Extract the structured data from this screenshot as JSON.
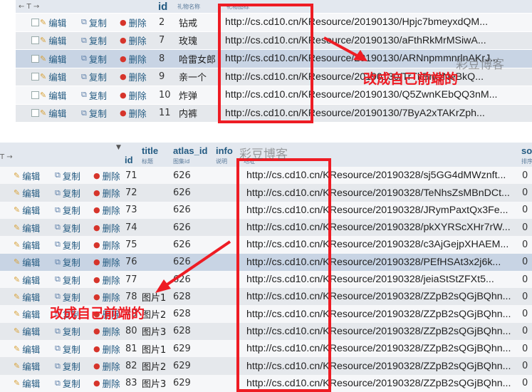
{
  "actions": {
    "edit": "编辑",
    "copy": "复制",
    "delete": "删除"
  },
  "table1": {
    "headers": {
      "sort": "← T →",
      "id": "id",
      "name": "礼物名称",
      "url": "礼物图标"
    },
    "rows": [
      {
        "id": "2",
        "name": "钻戒",
        "url": "http://cs.cd10.cn/KResource/20190130/Hpjc7bmeyxdQM..."
      },
      {
        "id": "7",
        "name": "玫瑰",
        "url": "http://cs.cd10.cn/KResource/20190130/aFthRkMrMSiwA..."
      },
      {
        "id": "8",
        "name": "哈雷女郎",
        "url": "http://cs.cd10.cn/KResource/20190130/ARNnpmmnrlnAKrJ..."
      },
      {
        "id": "9",
        "name": "亲一个",
        "url": "http://cs.cd10.cn/KResource/20190130/TrTkBnQNeBkQ..."
      },
      {
        "id": "10",
        "name": "炸弹",
        "url": "http://cs.cd10.cn/KResource/20190130/Q5ZwnKEbQQ3nM..."
      },
      {
        "id": "11",
        "name": "内裤",
        "url": "http://cs.cd10.cn/KResource/20190130/7ByA2xTAKrZph..."
      }
    ]
  },
  "table2": {
    "headers": {
      "sort": "T →",
      "id": "id",
      "title": "title",
      "title_sub": "标题",
      "atlas": "atlas_id",
      "atlas_sub": "图集id",
      "info": "info",
      "info_sub": "说明",
      "url_sub": "地址",
      "sort_col": "so",
      "sort_sub": "排序"
    },
    "rows": [
      {
        "id": "71",
        "title": "",
        "atlas": "626",
        "url": "http://cs.cd10.cn/KResource/20190328/sj5GG4dMWznft...",
        "so": "0"
      },
      {
        "id": "72",
        "title": "",
        "atlas": "626",
        "url": "http://cs.cd10.cn/KResource/20190328/TeNhsZsMBnDCt...",
        "so": "0"
      },
      {
        "id": "73",
        "title": "",
        "atlas": "626",
        "url": "http://cs.cd10.cn/KResource/20190328/JRymPaxtQx3Fe...",
        "so": "0"
      },
      {
        "id": "74",
        "title": "",
        "atlas": "626",
        "url": "http://cs.cd10.cn/KResource/20190328/pkXYRScXHr7rW...",
        "so": "0"
      },
      {
        "id": "75",
        "title": "",
        "atlas": "626",
        "url": "http://cs.cd10.cn/KResource/20190328/c3AjGejpXHAEM...",
        "so": "0"
      },
      {
        "id": "76",
        "title": "",
        "atlas": "626",
        "url": "http://cs.cd10.cn/KResource/20190328/PEfHSAt3x2j6k...",
        "so": "0"
      },
      {
        "id": "77",
        "title": "",
        "atlas": "626",
        "url": "http://cs.cd10.cn/KResource/20190328/jeiaStStZFXt5...",
        "so": "0"
      },
      {
        "id": "78",
        "title": "图片1",
        "atlas": "628",
        "url": "http://cs.cd10.cn/KResource/20190328/ZZpB2sQGjBQhn...",
        "so": "0"
      },
      {
        "id": "79",
        "title": "图片2",
        "atlas": "628",
        "url": "http://cs.cd10.cn/KResource/20190328/ZZpB2sQGjBQhn...",
        "so": "0"
      },
      {
        "id": "80",
        "title": "图片3",
        "atlas": "628",
        "url": "http://cs.cd10.cn/KResource/20190328/ZZpB2sQGjBQhn...",
        "so": "0"
      },
      {
        "id": "81",
        "title": "图片1",
        "atlas": "629",
        "url": "http://cs.cd10.cn/KResource/20190328/ZZpB2sQGjBQhn...",
        "so": "0"
      },
      {
        "id": "82",
        "title": "图片2",
        "atlas": "629",
        "url": "http://cs.cd10.cn/KResource/20190328/ZZpB2sQGjBQhn...",
        "so": "0"
      },
      {
        "id": "83",
        "title": "图片3",
        "atlas": "629",
        "url": "http://cs.cd10.cn/KResource/20190328/ZZpB2sQGjBQhn...",
        "so": "0"
      }
    ]
  },
  "annotations": {
    "note1": "改成自己前端的",
    "note2": "改成自己前端的"
  },
  "watermarks": {
    "wm1": "彩豆博客",
    "wm2": "彩豆博客"
  },
  "colors": {
    "annotation": "#ee1c24",
    "link": "#235a81"
  }
}
